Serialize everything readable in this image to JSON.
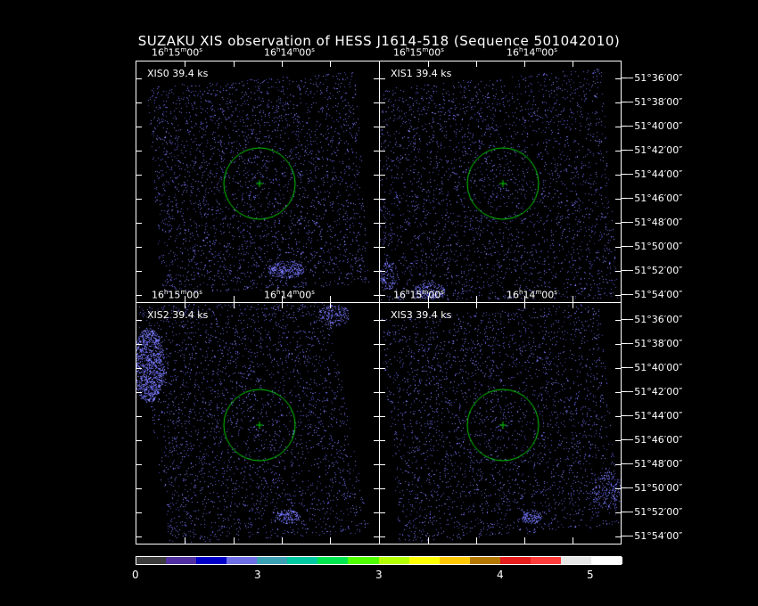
{
  "title": "SUZAKU XIS observation of HESS J1614-518  (Sequence 501042010)",
  "panels": [
    {
      "label": "XIS0 39.4 ks"
    },
    {
      "label": "XIS1 39.4 ks"
    },
    {
      "label": "XIS2 39.4 ks"
    },
    {
      "label": "XIS3 39.4 ks"
    }
  ],
  "ra_axis": {
    "h": "16",
    "m1": "15",
    "m2": "14",
    "s": "00",
    "unit_h": "h",
    "unit_m": "m",
    "unit_s": "s"
  },
  "dec_axis": [
    "−51°36′00″",
    "−51°38′00″",
    "−51°40′00″",
    "−51°42′00″",
    "−51°44′00″",
    "−51°46′00″",
    "−51°48′00″",
    "−51°50′00″",
    "−51°52′00″",
    "−51°54′00″"
  ],
  "colorbar": {
    "labels": [
      "0",
      "3",
      "3",
      "4",
      "5"
    ],
    "colors": [
      "#3c3c3c",
      "#5030a0",
      "#0000c8",
      "#6e6ee6",
      "#3ca0b4",
      "#00c8a0",
      "#00e650",
      "#50ff00",
      "#b4ff00",
      "#ffff00",
      "#ffc800",
      "#b47800",
      "#e61e1e",
      "#ff3c3c",
      "#e6e6e6",
      "#ffffff"
    ]
  },
  "colors": {
    "circle": "#00d200",
    "events": "#7878ff",
    "frame": "#ffffff"
  }
}
